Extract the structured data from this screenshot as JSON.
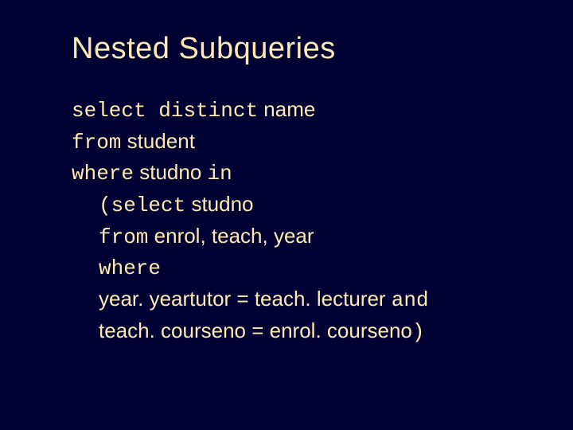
{
  "title": "Nested Subqueries",
  "sql": {
    "l1": {
      "select": "select",
      "distinct": "distinct",
      "name": " name"
    },
    "l2": {
      "from": "from",
      "student": " student"
    },
    "l3": {
      "where": "where",
      "studno": " studno ",
      "in": "in"
    },
    "l4": {
      "lp": "(",
      "select": "select",
      "studno": " studno"
    },
    "l5": {
      "from": "from",
      "tables": " enrol, teach, year"
    },
    "l6": {
      "where": "where"
    },
    "l7": {
      "expr": "year. yeartutor = teach. lecturer ",
      "and": "and"
    },
    "l8": {
      "expr": "teach. courseno = enrol. courseno",
      "rp": ")"
    }
  }
}
